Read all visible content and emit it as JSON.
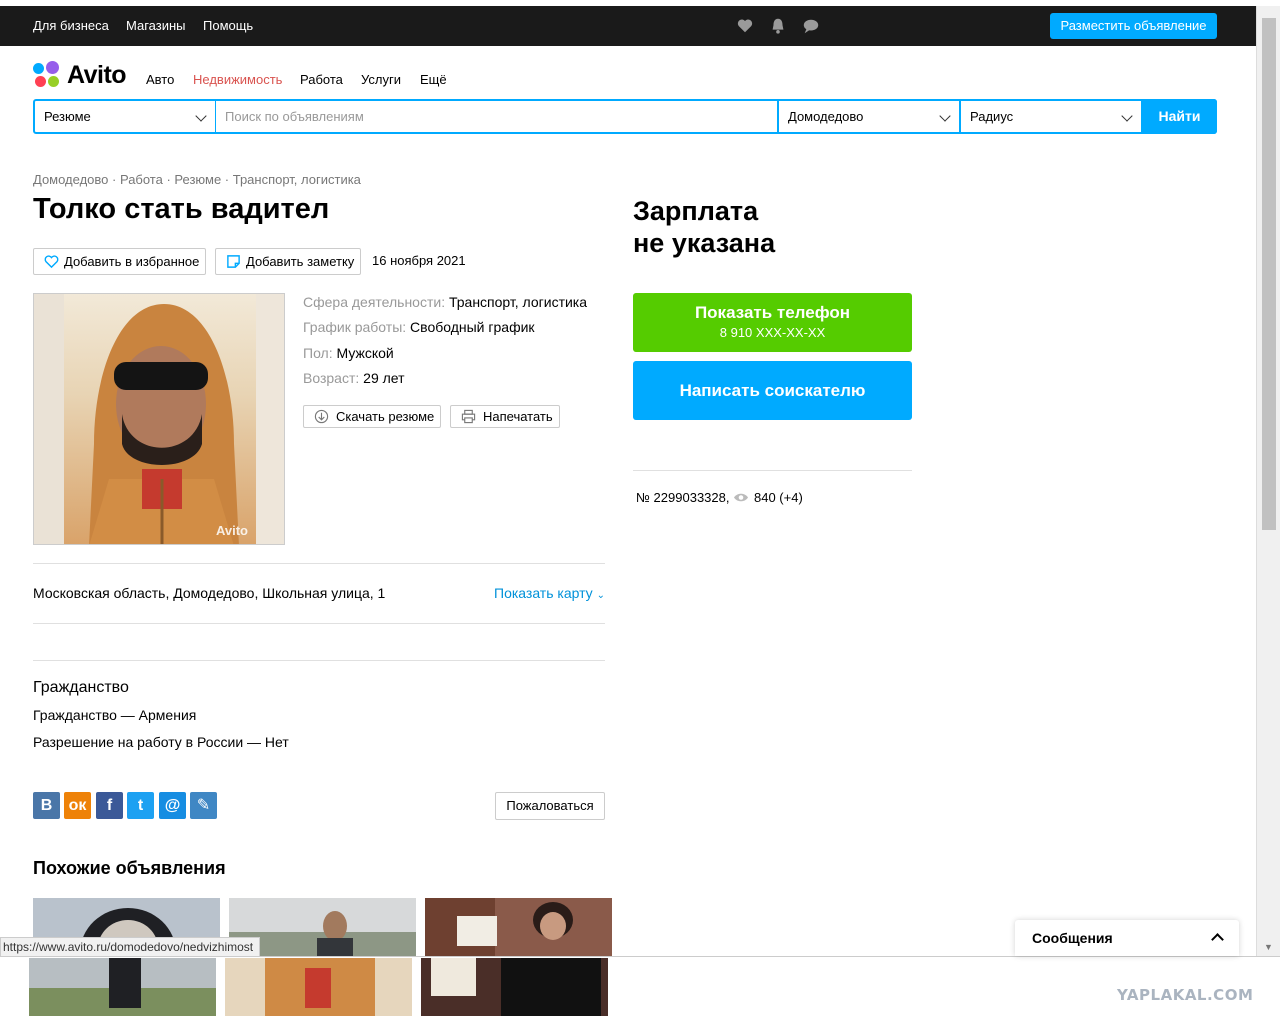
{
  "topbar": {
    "links": [
      "Для бизнеса",
      "Магазины",
      "Помощь"
    ],
    "post_button": "Разместить объявление"
  },
  "logo": {
    "text": "Avito"
  },
  "categories": [
    "Авто",
    "Недвижимость",
    "Работа",
    "Услуги",
    "Ещё"
  ],
  "search": {
    "category": "Резюме",
    "placeholder": "Поиск по объявлениям",
    "location": "Домодедово",
    "radius": "Радиус",
    "submit": "Найти"
  },
  "breadcrumb": "Домодедово · Работа · Резюме · Транспорт, логистика",
  "ad": {
    "title": "Толко стать вадител",
    "favorite_label": "Добавить в избранное",
    "note_label": "Добавить заметку",
    "date": "16 ноября 2021",
    "photo_watermark": "Avito",
    "params": [
      {
        "label": "Сфера деятельности:",
        "value": "Транспорт, логистика"
      },
      {
        "label": "График работы:",
        "value": "Свободный график"
      },
      {
        "label": "Пол:",
        "value": "Мужской"
      },
      {
        "label": "Возраст:",
        "value": "29 лет"
      }
    ],
    "download_label": "Скачать резюме",
    "print_label": "Напечатать",
    "address": "Московская область, Домодедово, Школьная улица, 1",
    "show_map": "Показать карту",
    "citizenship_heading": "Гражданство",
    "citizenship": "Гражданство — Армения",
    "work_permit": "Разрешение на работу в России — Нет",
    "complain": "Пожаловаться"
  },
  "sidebar": {
    "salary_line1": "Зарплата",
    "salary_line2": "не указана",
    "show_phone": "Показать телефон",
    "phone_mask": "8 910 XXX-XX-XX",
    "write": "Написать соискателю",
    "ad_number": "№ 2299033328,",
    "views": "840 (+4)"
  },
  "social_icons": [
    "vk-icon",
    "ok-icon",
    "facebook-icon",
    "twitter-icon",
    "mail-icon",
    "livejournal-icon"
  ],
  "similar_heading": "Похожие объявления",
  "status_url": "https://www.avito.ru/domodedovo/nedvizhimost",
  "messages_label": "Сообщения",
  "watermark": "YAPLAKAL.COM",
  "colors": {
    "accent": "#00aaff",
    "green": "#55cc00",
    "active_category": "#d9534f",
    "link": "#0091d9"
  }
}
